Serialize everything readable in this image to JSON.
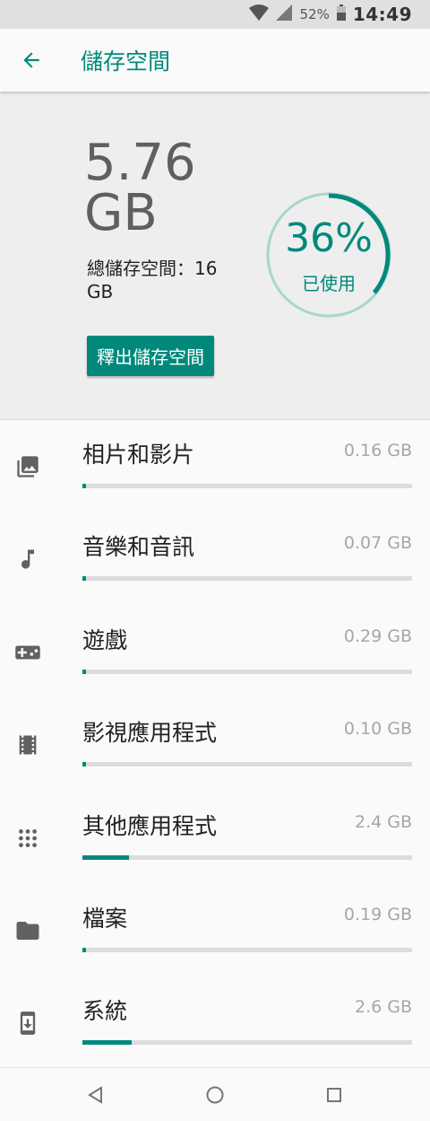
{
  "status_bar": {
    "battery": "52%",
    "time": "14:49"
  },
  "app_bar": {
    "title": "儲存空間"
  },
  "summary": {
    "used_amount": "5.76 GB",
    "total_text": "總儲存空間：16 GB",
    "used_percent": 36,
    "percent_text": "36%",
    "used_label": "已使用",
    "free_button": "釋出儲存空間"
  },
  "colors": {
    "accent": "#00897b",
    "track": "#dcdcdc",
    "donut_track": "#a8d5d0"
  },
  "categories": [
    {
      "label": "相片和影片",
      "size": "0.16 GB",
      "fraction": 0.01,
      "icon": "photo-icon"
    },
    {
      "label": "音樂和音訊",
      "size": "0.07 GB",
      "fraction": 0.0,
      "icon": "music-note-icon"
    },
    {
      "label": "遊戲",
      "size": "0.29 GB",
      "fraction": 0.01,
      "icon": "gamepad-icon"
    },
    {
      "label": "影視應用程式",
      "size": "0.10 GB",
      "fraction": 0.0,
      "icon": "movie-icon"
    },
    {
      "label": "其他應用程式",
      "size": "2.4 GB",
      "fraction": 0.14,
      "icon": "apps-grid-icon"
    },
    {
      "label": "檔案",
      "size": "0.19 GB",
      "fraction": 0.01,
      "icon": "folder-icon"
    },
    {
      "label": "系統",
      "size": "2.6 GB",
      "fraction": 0.15,
      "icon": "system-update-icon"
    }
  ]
}
